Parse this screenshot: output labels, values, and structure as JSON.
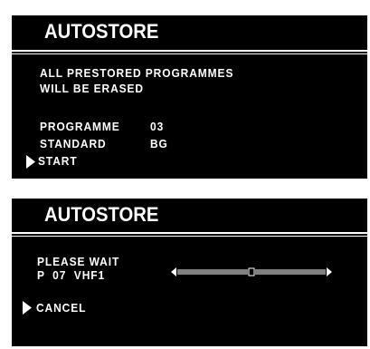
{
  "screen1": {
    "title": "AUTOSTORE",
    "message_line1": "ALL PRESTORED PROGRAMMES",
    "message_line2": "WILL BE ERASED",
    "programme_label": "PROGRAMME",
    "programme_value": "03",
    "standard_label": "STANDARD",
    "standard_value": "BG",
    "start_label": "START"
  },
  "screen2": {
    "title": "AUTOSTORE",
    "status_line1": "PLEASE WAIT",
    "status_line2": "P  07  VHF1",
    "cancel_label": "CANCEL",
    "progress_fraction": 0.5
  }
}
